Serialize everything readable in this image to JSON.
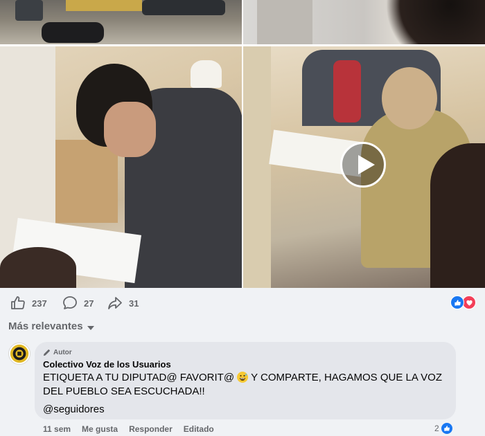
{
  "post": {
    "media": {
      "play_label": "Play video"
    },
    "stats": {
      "likes": "237",
      "comments": "27",
      "shares": "31"
    },
    "reactions": [
      "like",
      "love"
    ]
  },
  "comments": {
    "sort_label": "Más relevantes",
    "items": [
      {
        "badge": "Autor",
        "author": "Colectivo Voz de los Usuarios",
        "text_before_emoji": "ETIQUETA A TU DIPUTAD@ FAVORIT@ ",
        "emoji": "grinning-face-with-sweat",
        "text_after_emoji": " Y COMPARTE, HAGAMOS QUE LA VOZ DEL PUEBLO SEA ESCUCHADA!!",
        "mention": "@seguidores",
        "time": "11 sem",
        "like_label": "Me gusta",
        "reply_label": "Responder",
        "edited_label": "Editado",
        "like_count": "2"
      }
    ]
  },
  "colors": {
    "accent": "#1877f2",
    "love": "#f33e58",
    "bubble": "#e4e6eb",
    "muted_text": "#65676b"
  },
  "icons": [
    "thumb-up-outline-icon",
    "comment-bubble-icon",
    "share-arrow-icon",
    "play-icon",
    "pencil-icon",
    "caret-down-icon"
  ]
}
